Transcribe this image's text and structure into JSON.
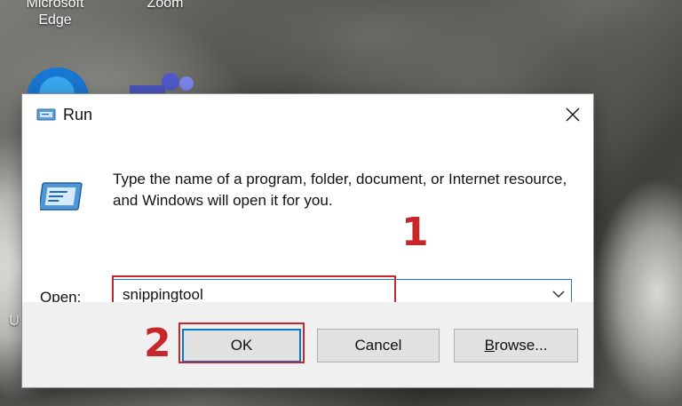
{
  "desktop": {
    "icons": [
      {
        "name": "edge",
        "label_line1": "Microsoft",
        "label_line2": "Edge"
      },
      {
        "name": "zoom",
        "label": "Zoom"
      }
    ],
    "partial_label": "U"
  },
  "dialog": {
    "title": "Run",
    "description": "Type the name of a program, folder, document, or Internet resource, and Windows will open it for you.",
    "open_label_prefix": "",
    "open_label_mnemonic": "O",
    "open_label_rest": "pen:",
    "open_value": "snippingtool",
    "buttons": {
      "ok": "OK",
      "cancel": "Cancel",
      "browse_mnemonic": "B",
      "browse_rest": "rowse..."
    }
  },
  "annotations": {
    "step1": "1",
    "step2": "2",
    "highlight_color": "#c7262b"
  },
  "colors": {
    "accent": "#0078d7",
    "footer_bg": "#f0f0f0"
  }
}
